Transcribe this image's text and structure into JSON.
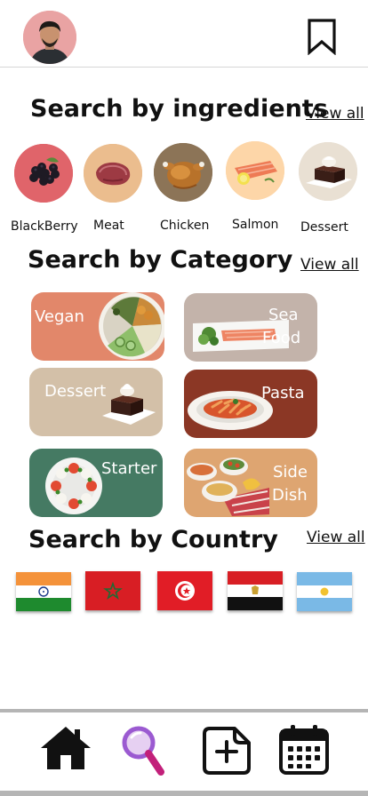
{
  "header": {
    "avatar_icon": "user-avatar-photo",
    "bookmark_icon": "bookmark-icon"
  },
  "ingredients": {
    "title": "Search by ingredients",
    "view_all": "View all",
    "items": [
      {
        "label": "BlackBerry",
        "icon": "blackberry-photo"
      },
      {
        "label": "Meat",
        "icon": "meat-photo"
      },
      {
        "label": "Chicken",
        "icon": "chicken-photo"
      },
      {
        "label": "Salmon",
        "icon": "salmon-photo"
      },
      {
        "label": "Dessert",
        "icon": "dessert-photo"
      }
    ]
  },
  "category": {
    "title": "Search by Category",
    "view_all": "View all",
    "items": [
      {
        "label": "Vegan",
        "color": "#E2876A"
      },
      {
        "label": "Sea Food",
        "line1": "Sea",
        "line2": "Food",
        "color": "#C3B3AA"
      },
      {
        "label": "Dessert",
        "color": "#D3C0A8"
      },
      {
        "label": "Pasta",
        "color": "#8B3725"
      },
      {
        "label": "Starter",
        "color": "#457A63"
      },
      {
        "label": "Side Dish",
        "line1": "Side",
        "line2": "Dish",
        "color": "#DEA571"
      }
    ]
  },
  "country": {
    "title": "Search by Country",
    "view_all": "View all",
    "flags": [
      {
        "icon": "india-flag-icon"
      },
      {
        "icon": "morocco-flag-icon"
      },
      {
        "icon": "tunisia-flag-icon"
      },
      {
        "icon": "egypt-flag-icon"
      },
      {
        "icon": "argentina-flag-icon"
      }
    ]
  },
  "nav": {
    "items": [
      {
        "icon": "home-icon",
        "active": false
      },
      {
        "icon": "search-icon",
        "active": true
      },
      {
        "icon": "add-icon",
        "active": false
      },
      {
        "icon": "calendar-icon",
        "active": false
      }
    ]
  }
}
